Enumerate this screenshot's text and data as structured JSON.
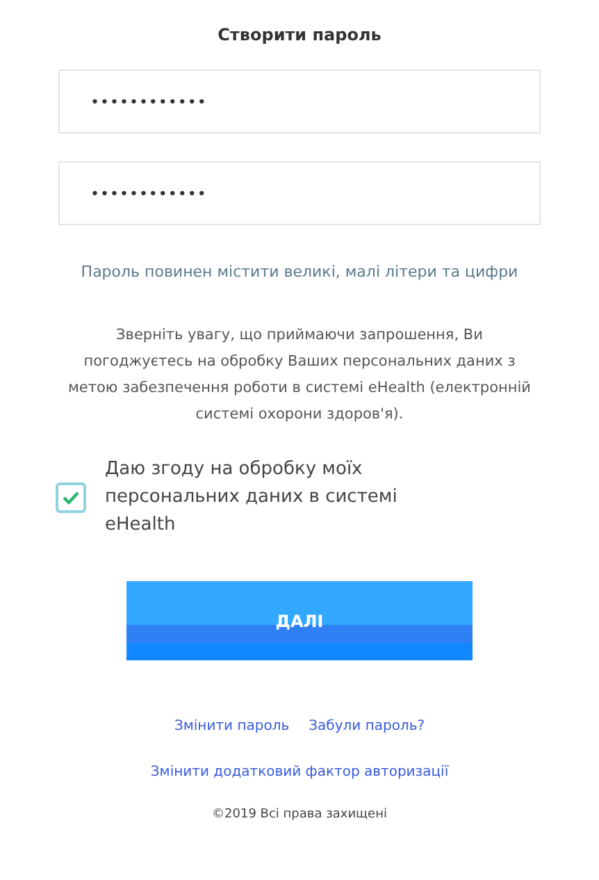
{
  "title": "Створити пароль",
  "fields": [
    {
      "value": "••••••••••••"
    },
    {
      "value": "••••••••••••"
    }
  ],
  "hint": "Пароль повинен містити великі, малі літери та цифри",
  "notice": "Зверніть увагу, що приймаючи запрошення, Ви погоджуєтесь на обробку Ваших персональних даних з метою забезпечення роботи в системі eHealth (електронній системі охорони здоров'я).",
  "consent": {
    "label": "Даю згоду на обробку моїх персональних даних в системі eHealth",
    "checked": true
  },
  "submit": "ДАЛІ",
  "links": [
    "Змінити пароль",
    "Забули пароль?"
  ],
  "link_2fa": "Змінити додатковий фактор авторизації",
  "copyright": "©2019 Всі права захищені"
}
